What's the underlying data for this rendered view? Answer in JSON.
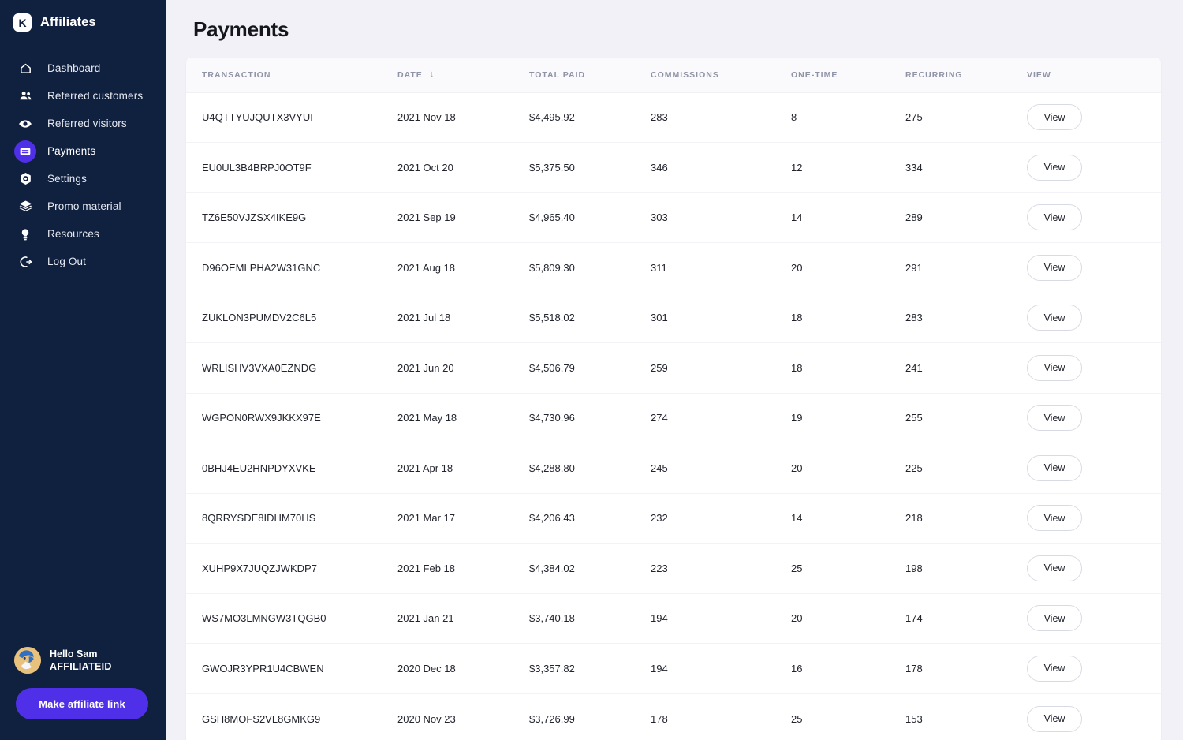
{
  "brand": {
    "mark": "K",
    "name": "Affiliates",
    "logo_icon": "k-logo-icon"
  },
  "sidebar": {
    "items": [
      {
        "label": "Dashboard",
        "icon": "home-icon",
        "active": false
      },
      {
        "label": "Referred customers",
        "icon": "people-icon",
        "active": false
      },
      {
        "label": "Referred visitors",
        "icon": "eye-icon",
        "active": false
      },
      {
        "label": "Payments",
        "icon": "card-icon",
        "active": true
      },
      {
        "label": "Settings",
        "icon": "gear-icon",
        "active": false
      },
      {
        "label": "Promo material",
        "icon": "layers-icon",
        "active": false
      },
      {
        "label": "Resources",
        "icon": "lightbulb-icon",
        "active": false
      },
      {
        "label": "Log Out",
        "icon": "logout-icon",
        "active": false
      }
    ],
    "user": {
      "greeting": "Hello Sam",
      "affiliate_id": "AFFILIATEID",
      "avatar_icon": "avatar"
    },
    "cta_label": "Make affiliate link"
  },
  "header": {
    "title": "Payments"
  },
  "table": {
    "columns": [
      {
        "key": "transaction",
        "label": "TRANSACTION",
        "sorted": false
      },
      {
        "key": "date",
        "label": "DATE",
        "sorted": true,
        "sort_direction": "desc",
        "sort_glyph": "↓"
      },
      {
        "key": "total_paid",
        "label": "TOTAL PAID",
        "sorted": false
      },
      {
        "key": "commissions",
        "label": "COMMISSIONS",
        "sorted": false
      },
      {
        "key": "one_time",
        "label": "ONE-TIME",
        "sorted": false
      },
      {
        "key": "recurring",
        "label": "RECURRING",
        "sorted": false
      },
      {
        "key": "view",
        "label": "VIEW",
        "sorted": false
      }
    ],
    "view_button_label": "View",
    "rows": [
      {
        "transaction": "U4QTTYUJQUTX3VYUI",
        "date": "2021 Nov 18",
        "total_paid": "$4,495.92",
        "commissions": "283",
        "one_time": "8",
        "recurring": "275"
      },
      {
        "transaction": "EU0UL3B4BRPJ0OT9F",
        "date": "2021 Oct 20",
        "total_paid": "$5,375.50",
        "commissions": "346",
        "one_time": "12",
        "recurring": "334"
      },
      {
        "transaction": "TZ6E50VJZSX4IKE9G",
        "date": "2021 Sep 19",
        "total_paid": "$4,965.40",
        "commissions": "303",
        "one_time": "14",
        "recurring": "289"
      },
      {
        "transaction": "D96OEMLPHA2W31GNC",
        "date": "2021 Aug 18",
        "total_paid": "$5,809.30",
        "commissions": "311",
        "one_time": "20",
        "recurring": "291"
      },
      {
        "transaction": "ZUKLON3PUMDV2C6L5",
        "date": "2021 Jul 18",
        "total_paid": "$5,518.02",
        "commissions": "301",
        "one_time": "18",
        "recurring": "283"
      },
      {
        "transaction": "WRLISHV3VXA0EZNDG",
        "date": "2021 Jun 20",
        "total_paid": "$4,506.79",
        "commissions": "259",
        "one_time": "18",
        "recurring": "241"
      },
      {
        "transaction": "WGPON0RWX9JKKX97E",
        "date": "2021 May 18",
        "total_paid": "$4,730.96",
        "commissions": "274",
        "one_time": "19",
        "recurring": "255"
      },
      {
        "transaction": "0BHJ4EU2HNPDYXVKE",
        "date": "2021 Apr 18",
        "total_paid": "$4,288.80",
        "commissions": "245",
        "one_time": "20",
        "recurring": "225"
      },
      {
        "transaction": "8QRRYSDE8IDHM70HS",
        "date": "2021 Mar 17",
        "total_paid": "$4,206.43",
        "commissions": "232",
        "one_time": "14",
        "recurring": "218"
      },
      {
        "transaction": "XUHP9X7JUQZJWKDP7",
        "date": "2021 Feb 18",
        "total_paid": "$4,384.02",
        "commissions": "223",
        "one_time": "25",
        "recurring": "198"
      },
      {
        "transaction": "WS7MO3LMNGW3TQGB0",
        "date": "2021 Jan 21",
        "total_paid": "$3,740.18",
        "commissions": "194",
        "one_time": "20",
        "recurring": "174"
      },
      {
        "transaction": "GWOJR3YPR1U4CBWEN",
        "date": "2020 Dec 18",
        "total_paid": "$3,357.82",
        "commissions": "194",
        "one_time": "16",
        "recurring": "178"
      },
      {
        "transaction": "GSH8MOFS2VL8GMKG9",
        "date": "2020 Nov 23",
        "total_paid": "$3,726.99",
        "commissions": "178",
        "one_time": "25",
        "recurring": "153"
      }
    ]
  },
  "colors": {
    "sidebar_bg": "#10203f",
    "accent": "#4f2fe8",
    "page_bg": "#f1f1f7",
    "card_bg": "#ffffff",
    "header_text": "#8f93a6"
  }
}
